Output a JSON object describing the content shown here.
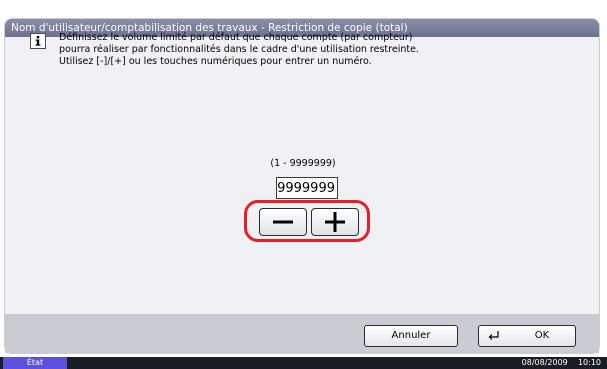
{
  "title": "Nom d'utilisateur/comptabilisation des travaux - Restriction de copie (total)",
  "info_icon": "info-icon",
  "message": {
    "line1": "Définissez le volume limité par défaut que chaque compte (par compteur)",
    "line2": "pourra réaliser par fonctionnalités dans le cadre d'une utilisation restreinte.",
    "line3": "Utilisez [-]/[+] ou les touches numériques pour entrer un numéro."
  },
  "range_text": "(1 - 9999999)",
  "value": "9999999",
  "stepper": {
    "minus_icon": "minus-icon",
    "plus_icon": "plus-icon",
    "highlight_color": "#e3202a"
  },
  "buttons": {
    "cancel": "Annuler",
    "ok": "OK",
    "ok_icon": "enter-icon"
  },
  "status": {
    "tab_label": "État",
    "date": "08/08/2009",
    "time": "10:10"
  },
  "colors": {
    "title_bar": "#7a7f9c",
    "status_tab": "#5f4fe0",
    "status_bar": "#1b1d24"
  }
}
